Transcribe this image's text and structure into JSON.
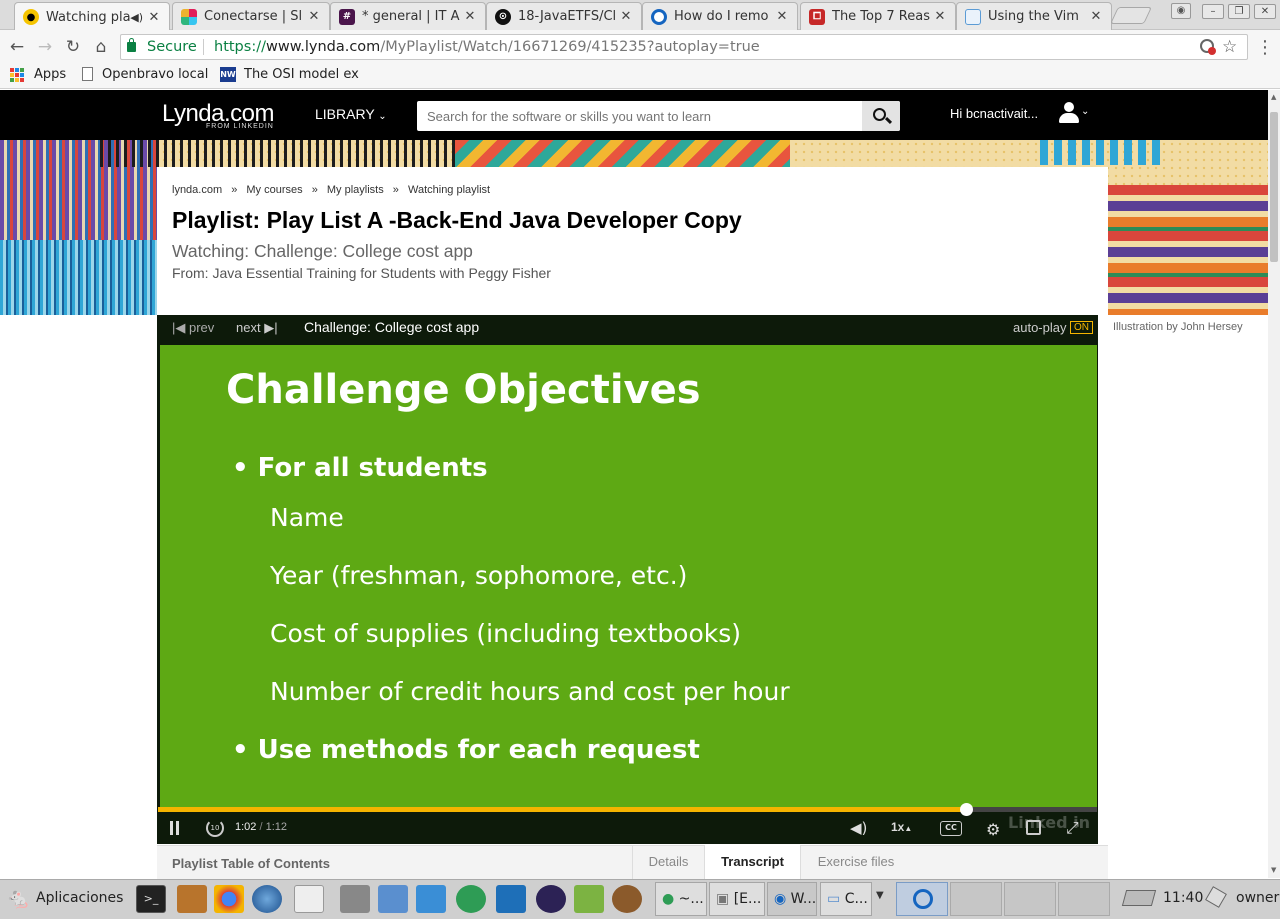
{
  "browser": {
    "tabs": [
      {
        "title": "Watching pla",
        "icon": "lynda-icon",
        "active": true
      },
      {
        "title": "Conectarse | Sl",
        "icon": "slack-icon"
      },
      {
        "title": "* general | IT A",
        "icon": "slack-hash-icon"
      },
      {
        "title": "18-JavaETFS/Cl",
        "icon": "github-icon"
      },
      {
        "title": "How do I remo",
        "icon": "globe-blue-icon"
      },
      {
        "title": "The Top 7 Reas",
        "icon": "red-book-icon"
      },
      {
        "title": "Using the Vim",
        "icon": "page-icon"
      }
    ],
    "secure_label": "Secure",
    "url_scheme": "https://",
    "url_host": "www.lynda.com",
    "url_path": "/MyPlaylist/Watch/16671269/415235?autoplay=true",
    "bookmarks": [
      {
        "label": "Apps",
        "icon": "apps-grid-icon"
      },
      {
        "label": "Openbravo local",
        "icon": "page-icon"
      },
      {
        "label": "The OSI model ex",
        "icon": "nw-icon"
      }
    ],
    "nw_icon_text": "NW"
  },
  "lynda": {
    "logo": "Lynda.com",
    "logo_sub": "FROM LINKEDIN",
    "library_label": "LIBRARY",
    "search_placeholder": "Search for the software or skills you want to learn",
    "greeting": "Hi bcnactivait...",
    "breadcrumbs": [
      "lynda.com",
      "My courses",
      "My playlists",
      "Watching playlist"
    ],
    "breadcrumb_sep": "»",
    "playlist_title": "Playlist: Play List A -Back-End Java Developer Copy",
    "watching": "Watching: Challenge: College cost app",
    "from": "From: Java Essential Training for Students with Peggy Fisher",
    "illustration_credit": "Illustration by John Hersey"
  },
  "player": {
    "prev_label": "prev",
    "next_label": "next",
    "video_title": "Challenge: College cost app",
    "autoplay_label": "auto-play",
    "autoplay_state": "ON",
    "current_time": "1:02",
    "time_sep": "/",
    "duration": "1:12",
    "progress_percent": 86,
    "speed": "1x",
    "cc_label": "CC",
    "replay_seconds": "10",
    "slide": {
      "title": "Challenge Objectives",
      "bullet1": "For all students",
      "sub_items": [
        "Name",
        "Year (freshman, sophomore, etc.)",
        "Cost of supplies (including textbooks)",
        "Number of credit hours and cost per hour"
      ],
      "bullet2": "Use methods for each request"
    },
    "watermark": "Linked in"
  },
  "bottom_tabs": {
    "toc_label": "Playlist Table of Contents",
    "tabs": [
      "Details",
      "Transcript",
      "Exercise files"
    ],
    "active": "Transcript"
  },
  "taskbar": {
    "start_label": "Aplicaciones",
    "windows": [
      "~...",
      "[E...",
      "W...",
      "C..."
    ],
    "clock": "11:40",
    "user": "owner"
  },
  "colors": {
    "lynda_header": "#000000",
    "slide_green": "#5ea914",
    "progress": "#f5b400",
    "secure_green": "#0b8043",
    "autoplay_on": "#f5b400"
  }
}
